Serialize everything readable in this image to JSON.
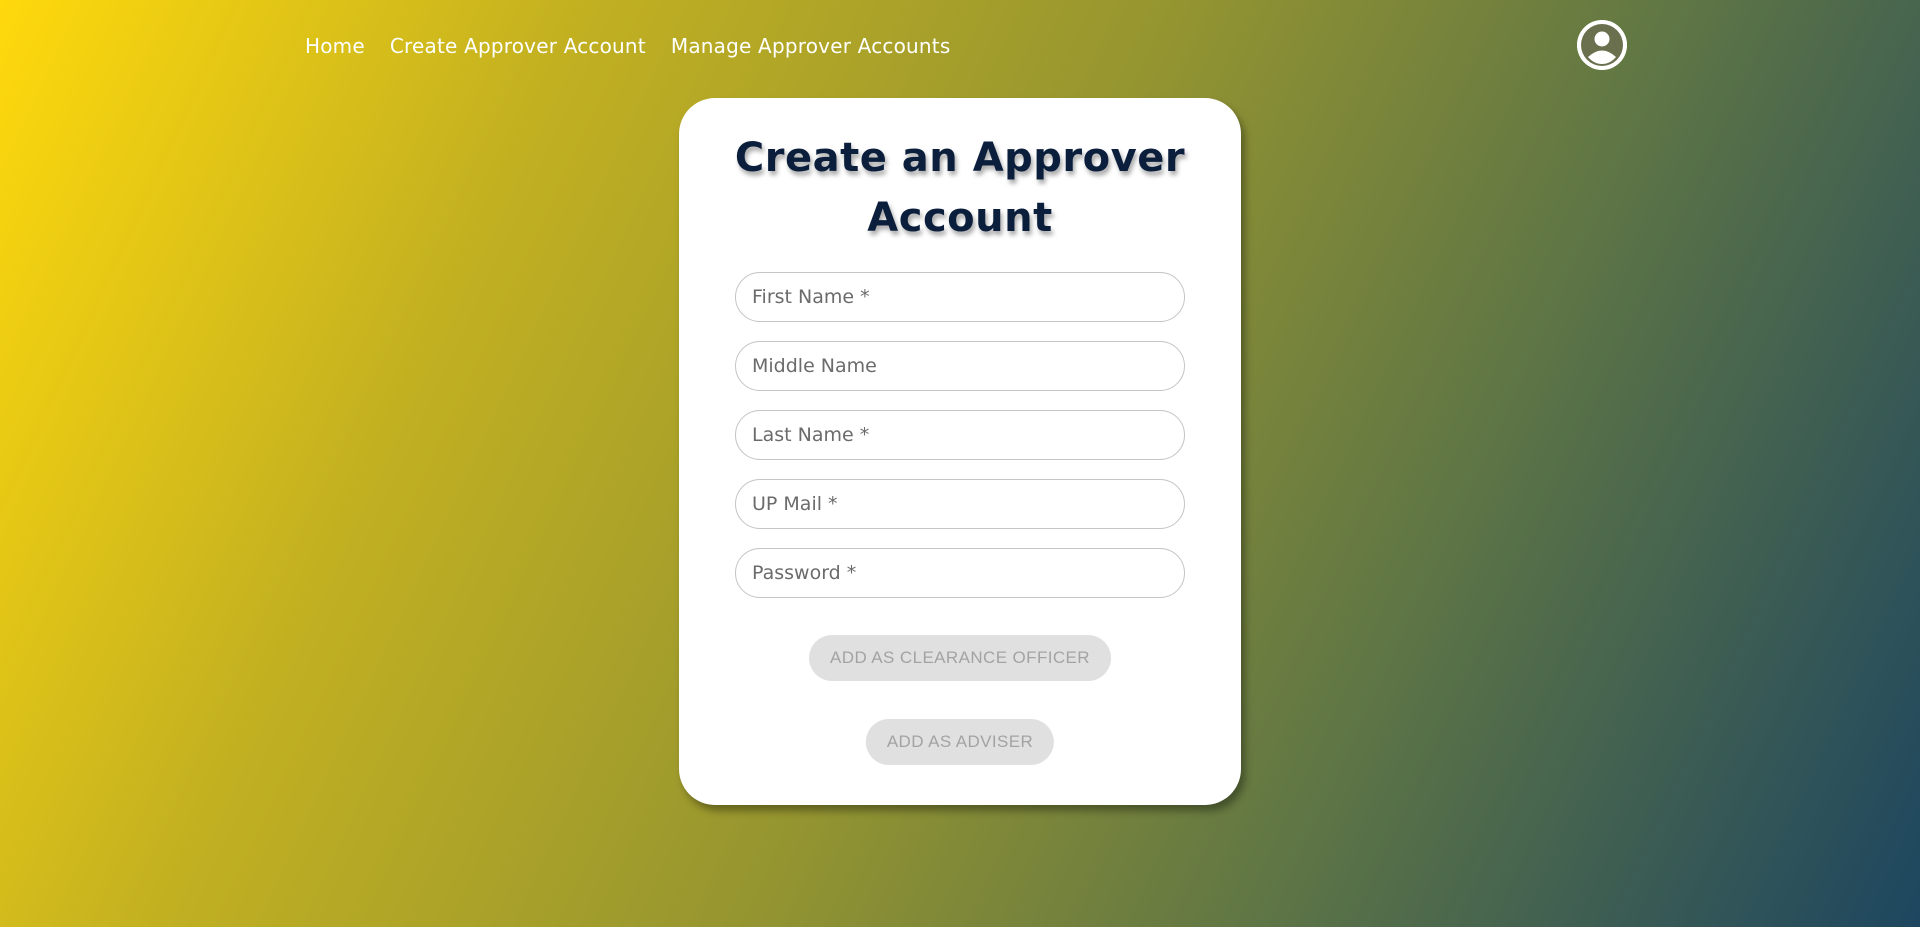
{
  "nav": {
    "items": [
      {
        "label": "Home"
      },
      {
        "label": "Create Approver Account"
      },
      {
        "label": "Manage Approver Accounts"
      }
    ]
  },
  "account": {
    "icon": "account-circle-icon"
  },
  "form": {
    "title": "Create an Approver Account",
    "fields": {
      "first_name": {
        "placeholder": "First Name *",
        "value": ""
      },
      "middle_name": {
        "placeholder": "Middle Name",
        "value": ""
      },
      "last_name": {
        "placeholder": "Last Name *",
        "value": ""
      },
      "up_mail": {
        "placeholder": "UP Mail *",
        "value": ""
      },
      "password": {
        "placeholder": "Password *",
        "value": ""
      }
    },
    "buttons": {
      "clearance_officer": "ADD AS CLEARANCE OFFICER",
      "adviser": "ADD AS ADVISER"
    }
  },
  "colors": {
    "gradient_start": "#ffd90c",
    "gradient_end": "#1d4660",
    "title": "#0b1f3d",
    "button_disabled_bg": "#e0e0e0",
    "button_disabled_text": "#a3a3a3"
  }
}
